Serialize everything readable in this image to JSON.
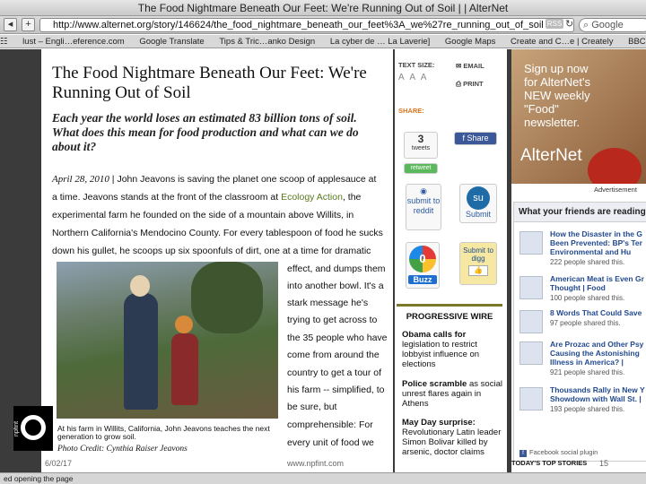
{
  "window": {
    "title": "The Food Nightmare Beneath Our Feet: We're Running Out of Soil | | AlterNet"
  },
  "toolbar": {
    "url": "http://www.alternet.org/story/146624/the_food_nightmare_beneath_our_feet%3A_we%27re_running_out_of_soil",
    "rss_label": "RSS",
    "search_placeholder": "Google",
    "back_label": "◂",
    "add_label": "+"
  },
  "bookmarks": [
    "lust – Engli…eference.com",
    "Google Translate",
    "Tips & Tric…anko Design",
    "La cyber de … La Laverie]",
    "Google Maps",
    "Create and C…e | Creately",
    "BBC N"
  ],
  "article": {
    "headline": "The Food Nightmare Beneath Our Feet: We're Running Out of Soil",
    "dek": "Each year the world loses an estimated 83 billion tons of soil. What does this mean for food production and what can we do about it?",
    "date": "April 28, 2010",
    "lines": [
      "| John Jeavons is saving the planet one scoop of applesauce at",
      "a time. Jeavons stands at the front of the classroom at",
      "experimental farm he founded on the side of a mountain above Willits, in",
      "Northern California's Mendocino County. For every tablespoon of food he sucks",
      "down his gullet, he scoops up six spoonfuls of dirt, one at a time for dramatic"
    ],
    "link_text": "Ecology Action",
    "line2_tail": ", the",
    "side_lines": [
      "effect, and dumps them",
      "into another bowl. It's a",
      "stark message he's",
      "trying to get across to",
      "the 35 people who have",
      "come from around the",
      "country to get a tour of",
      "his farm -- simplified, to",
      "be sure, but",
      "comprehensible: For",
      "every unit of food we"
    ],
    "caption": "At his farm in Willits, California, John Jeavons teaches the next generation to grow soil.",
    "credit": "Photo Credit: Cynthia Raiser Jeavons"
  },
  "tools": {
    "text_size_label": "TEXT SIZE:",
    "text_size_options": "A A A",
    "email_label": "EMAIL",
    "print_label": "PRINT",
    "share_label": "SHARE:",
    "tweet_count": "3",
    "tweet_label": "tweets",
    "retweet_label": "retweet",
    "fb_share_label": "Share",
    "reddit_label": "submit to reddit",
    "stumble_label": "Submit",
    "buzz_count": "0",
    "buzz_label": "Buzz",
    "digg_label": "Submit to digg",
    "wire_title": "PROGRESSIVE WIRE",
    "wire": [
      {
        "bold": "Obama calls for",
        "rest": "legislation to restrict lobbyist influence on elections"
      },
      {
        "bold": "Police scramble",
        "rest": "as social unrest flares again in Athens"
      },
      {
        "bold": "May Day surprise:",
        "rest": "Revolutionary Latin leader Simon Bolivar killed by arsenic, doctor claims"
      }
    ]
  },
  "sidebar": {
    "ad_text": "Sign up now for AlterNet's NEW weekly \"Food\" newsletter.",
    "ad_logo": "AlterNet",
    "ad_label": "Advertisement",
    "friends_title": "What your friends are reading",
    "items": [
      {
        "title": "How the Disaster in the G Been Prevented: BP's Ter Environmental and Hu",
        "shares": "222 people shared this."
      },
      {
        "title": "American Meat is Even Gr Thought | Food",
        "shares": "100 people shared this."
      },
      {
        "title": "8 Words That Could Save",
        "shares": "97 people shared this."
      },
      {
        "title": "Are Prozac and Other Psy Causing the Astonishing Illness in America? |",
        "shares": "921 people shared this."
      },
      {
        "title": "Thousands Rally in New Y Showdown with Wall St. |",
        "shares": "193 people shared this."
      }
    ],
    "fb_plugin": "Facebook social plugin",
    "todays": "TODAY'S TOP STORIES"
  },
  "status": {
    "text": "ed opening the page"
  },
  "overlay": {
    "date": "6/02/17",
    "url": "www.npfint.com",
    "number": "15",
    "logo": "npfint"
  }
}
